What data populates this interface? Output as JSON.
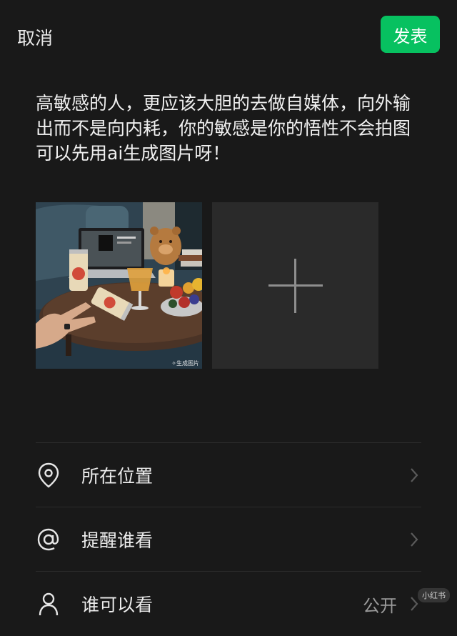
{
  "header": {
    "cancel_label": "取消",
    "publish_label": "发表"
  },
  "post": {
    "text": "高敏感的人，更应该大胆的去做自媒体，向外输出而不是向内耗，你的敏感是你的悟性不会拍图可以先用ai生成图片呀！",
    "images": [
      {
        "watermark": "✧生成图片"
      }
    ],
    "add_icon": "plus-icon"
  },
  "options": [
    {
      "label": "所在位置",
      "value": "",
      "icon": "location-pin-icon"
    },
    {
      "label": "提醒谁看",
      "value": "",
      "icon": "at-sign-icon"
    },
    {
      "label": "谁可以看",
      "value": "公开",
      "icon": "person-icon"
    }
  ],
  "watermark_brand": "小红书",
  "colors": {
    "background": "#191919",
    "accent": "#07c160",
    "text": "#ececec",
    "muted": "#9a9a9a",
    "tile": "#2a2a2a"
  }
}
